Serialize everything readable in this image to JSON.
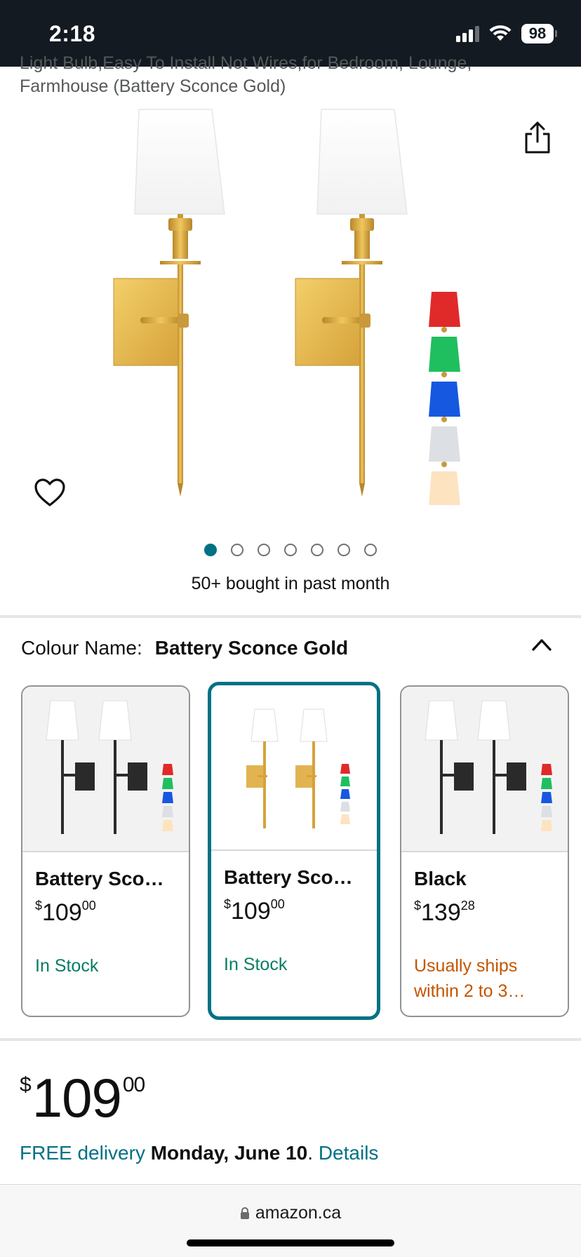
{
  "status_bar": {
    "time": "2:18",
    "battery": "98"
  },
  "title_fragment": {
    "line1": "Light Bulb,Easy To Install Not Wires,for Bedroom, Lounge,",
    "line2": "Farmhouse (Battery Sconce Gold)"
  },
  "icons": {
    "share": "share-icon",
    "wishlist": "heart-icon",
    "collapse": "chevron-up-icon",
    "lock": "lock-icon"
  },
  "carousel": {
    "total": 7,
    "active_index": 0
  },
  "bought_text": "50+ bought in past month",
  "colour": {
    "label": "Colour Name:",
    "value": "Battery Sconce Gold"
  },
  "swatches": [
    {
      "name": "Battery Sco…",
      "currency": "$",
      "price_whole": "109",
      "price_cents": "00",
      "stock": "In Stock",
      "finish": "black",
      "selected": false
    },
    {
      "name": "Battery Sco…",
      "currency": "$",
      "price_whole": "109",
      "price_cents": "00",
      "stock": "In Stock",
      "finish": "gold",
      "selected": true
    },
    {
      "name": "Black",
      "currency": "$",
      "price_whole": "139",
      "price_cents": "28",
      "stock_line1": "Usually ships",
      "stock_line2": "within 2 to 3…",
      "finish": "black",
      "selected": false
    }
  ],
  "price": {
    "currency": "$",
    "whole": "109",
    "cents": "00"
  },
  "delivery": {
    "prefix": "FREE delivery",
    "date": "Monday, June 10",
    "separator": ".",
    "link": "Details"
  },
  "browser": {
    "url": "amazon.ca"
  },
  "colors": {
    "teal": "#007185",
    "green": "#067d62",
    "orange": "#c45500",
    "status_bg": "#131a22"
  }
}
